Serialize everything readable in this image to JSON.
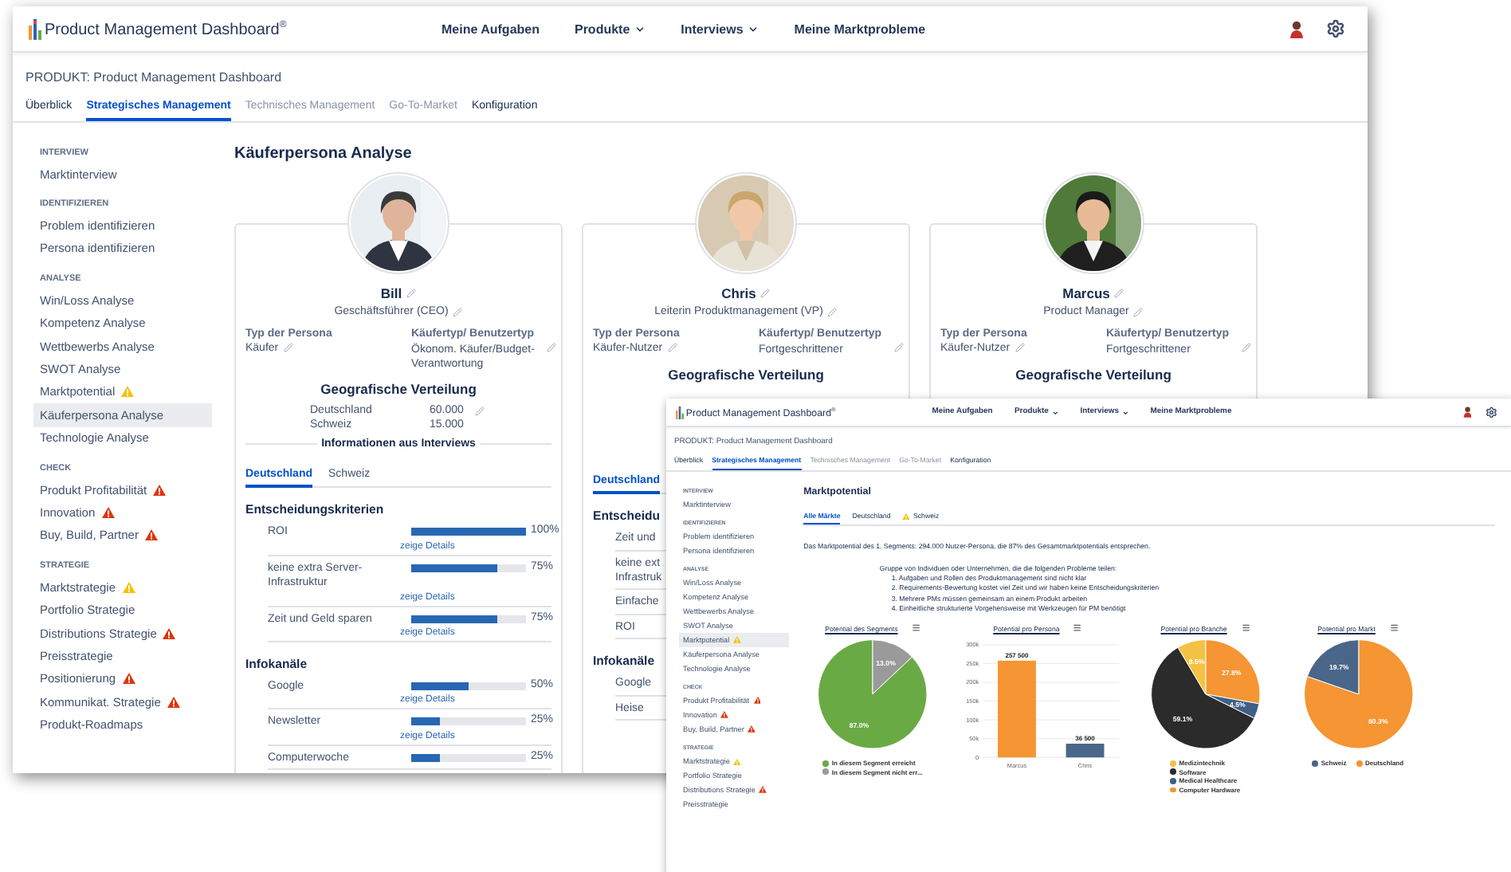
{
  "main_window": {
    "app_title": "Product Management Dashboard$^{®}$",
    "nav": [
      {
        "label": "Meine Aufgaben",
        "dropdown": false
      },
      {
        "label": "Produkte",
        "dropdown": true
      },
      {
        "label": "Interviews",
        "dropdown": true
      },
      {
        "label": "Meine Marktprobleme",
        "dropdown": false
      }
    ],
    "product_line": "PRODUKT: Product Management Dashboard",
    "tabs": [
      {
        "label": "Überblick",
        "selected": false,
        "disabled": false
      },
      {
        "label": "Strategisches Management",
        "selected": true,
        "disabled": false
      },
      {
        "label": "Technisches Management",
        "selected": false,
        "disabled": true
      },
      {
        "label": "Go-To-Market",
        "selected": false,
        "disabled": true
      },
      {
        "label": "Konfiguration",
        "selected": false,
        "disabled": false
      }
    ],
    "sidebar": [
      {
        "heading": "INTERVIEW",
        "items": [
          {
            "label": "Marktinterview",
            "selected": false
          }
        ]
      },
      {
        "heading": "IDENTIFIZIEREN",
        "items": [
          {
            "label": "Problem identifizieren",
            "selected": false
          },
          {
            "label": "Persona identifizieren",
            "selected": false
          }
        ]
      },
      {
        "heading": "ANALYSE",
        "items": [
          {
            "label": "Win/Loss Analyse",
            "selected": false
          },
          {
            "label": "Kompetenz Analyse",
            "selected": false
          },
          {
            "label": "Wettbewerbs Analyse",
            "selected": false
          },
          {
            "label": "SWOT Analyse",
            "selected": false
          },
          {
            "label": "Marktpotential",
            "selected": false,
            "color": "#f2c200"
          },
          {
            "label": "Käuferpersona Analyse",
            "selected": true
          },
          {
            "label": "Technologie Analyse",
            "selected": false
          }
        ]
      },
      {
        "heading": "CHECK",
        "items": [
          {
            "label": "Produkt Profitabilität",
            "selected": false,
            "color": "#de350b"
          },
          {
            "label": "Innovation",
            "selected": false,
            "color": "#de350b"
          },
          {
            "label": "Buy, Build, Partner",
            "selected": false,
            "color": "#de350b"
          }
        ]
      },
      {
        "heading": "STRATEGIE",
        "items": [
          {
            "label": "Marktstrategie",
            "selected": false,
            "color": "#f2c200"
          },
          {
            "label": "Portfolio Strategie",
            "selected": false
          },
          {
            "label": "Distributions Strategie",
            "selected": false,
            "color": "#de350b"
          },
          {
            "label": "Preisstrategie",
            "selected": false
          },
          {
            "label": "Positionierung",
            "selected": false,
            "color": "#de350b"
          },
          {
            "label": "Kommunikat. Strategie",
            "selected": false,
            "color": "#de350b"
          },
          {
            "label": "Produkt-Roadmaps",
            "selected": false
          }
        ]
      }
    ],
    "page_title": "Käuferpersona Analyse",
    "personas": [
      {
        "name": "Bill",
        "role": "Geschäftsführer (CEO)",
        "type_label": "Typ der Persona",
        "type": "Käufer",
        "buyer_label": "Käufertyp/ Benutzertyp",
        "buyer": "Ökonom. Käufer/Budget-Verantwortung",
        "geo_title": "Geografische Verteilung",
        "geo": [
          {
            "country": "Deutschland",
            "value": "60.000"
          },
          {
            "country": "Schweiz",
            "value": "15.000"
          }
        ],
        "interviews_title": "Informationen aus Interviews",
        "tabs": [
          {
            "label": "Deutschland",
            "selected": true
          },
          {
            "label": "Schweiz",
            "selected": false
          }
        ],
        "sections": [
          {
            "title": "Entscheidungskriterien",
            "rows": [
              {
                "label": "ROI",
                "level": 1,
                "reading": "100%",
                "link": "zeige Details"
              },
              {
                "label": "keine extra Server-Infrastruktur",
                "level": 0.75,
                "reading": "75%",
                "link": "zeige Details"
              },
              {
                "label": "Zeit und Geld sparen",
                "level": 0.75,
                "reading": "75%",
                "link": "zeige Details"
              }
            ]
          },
          {
            "title": "Infokanäle",
            "rows": [
              {
                "label": "Google",
                "level": 0.5,
                "reading": "50%",
                "link": "zeige Details"
              },
              {
                "label": "Newsletter",
                "level": 0.25,
                "reading": "25%",
                "link": "zeige Details"
              },
              {
                "label": "Computerwoche",
                "level": 0.25,
                "reading": "25%"
              }
            ]
          }
        ]
      },
      {
        "name": "Chris",
        "role": "Leiterin Produktmanagement (VP)",
        "type_label": "Typ der Persona",
        "type": "Käufer-Nutzer",
        "buyer_label": "Käufertyp/ Benutzertyp",
        "buyer": "Fortgeschrittener",
        "geo_title": "Geografische Verteilung",
        "tabs": [
          {
            "label": "Deutschland",
            "selected": true
          }
        ],
        "sections": [
          {
            "title": "Entscheidu",
            "rows": [
              {
                "label": "Zeit und"
              },
              {
                "label": "keine ext Infrastruk"
              },
              {
                "label": "Einfache"
              },
              {
                "label": "ROI"
              }
            ]
          },
          {
            "title": "Infokanäle",
            "rows": [
              {
                "label": "Google"
              },
              {
                "label": "Heise"
              }
            ]
          }
        ]
      },
      {
        "name": "Marcus",
        "role": "Product Manager",
        "type_label": "Typ der Persona",
        "type": "Käufer-Nutzer",
        "buyer_label": "Käufertyp/ Benutzertyp",
        "buyer": "Fortgeschrittener",
        "geo_title": "Geografische Verteilung"
      }
    ]
  },
  "overlay_window": {
    "app_title": "Product Management Dashboard$^{®}$",
    "nav": [
      {
        "label": "Meine Aufgaben",
        "dropdown": false
      },
      {
        "label": "Produkte",
        "dropdown": true
      },
      {
        "label": "Interviews",
        "dropdown": true
      },
      {
        "label": "Meine Marktprobleme",
        "dropdown": false
      }
    ],
    "product_line": "PRODUKT: Product Management Dashboard",
    "tabs": [
      {
        "label": "Überblick",
        "selected": false,
        "disabled": false
      },
      {
        "label": "Strategisches Management",
        "selected": true,
        "disabled": false
      },
      {
        "label": "Technisches Management",
        "selected": false,
        "disabled": true
      },
      {
        "label": "Go-To-Market",
        "selected": false,
        "disabled": true
      },
      {
        "label": "Konfiguration",
        "selected": false,
        "disabled": false
      }
    ],
    "sidebar": [
      {
        "heading": "INTERVIEW",
        "items": [
          {
            "label": "Marktinterview",
            "selected": false
          }
        ]
      },
      {
        "heading": "IDENTIFIZIEREN",
        "items": [
          {
            "label": "Problem identifizieren",
            "selected": false
          },
          {
            "label": "Persona identifizieren",
            "selected": false
          }
        ]
      },
      {
        "heading": "ANALYSE",
        "items": [
          {
            "label": "Win/Loss Analyse",
            "selected": false
          },
          {
            "label": "Kompetenz Analyse",
            "selected": false
          },
          {
            "label": "Wettbewerbs Analyse",
            "selected": false
          },
          {
            "label": "SWOT Analyse",
            "selected": false
          },
          {
            "label": "Marktpotential",
            "selected": true,
            "color": "#f2c200"
          },
          {
            "label": "Käuferpersona Analyse",
            "selected": false
          },
          {
            "label": "Technologie Analyse",
            "selected": false
          }
        ]
      },
      {
        "heading": "CHECK",
        "items": [
          {
            "label": "Produkt Profitabilität",
            "selected": false,
            "color": "#de350b"
          },
          {
            "label": "Innovation",
            "selected": false,
            "color": "#de350b"
          },
          {
            "label": "Buy, Build, Partner",
            "selected": false,
            "color": "#de350b"
          }
        ]
      },
      {
        "heading": "STRATEGIE",
        "items": [
          {
            "label": "Marktstrategie",
            "selected": false,
            "color": "#f2c200"
          },
          {
            "label": "Portfolio Strategie",
            "selected": false
          },
          {
            "label": "Distributions Strategie",
            "selected": false,
            "color": "#de350b"
          },
          {
            "label": "Preisstrategie",
            "selected": false
          }
        ]
      }
    ],
    "page_title": "Marktpotential",
    "market_tabs": [
      {
        "label": "Alle Märkte",
        "selected": true
      },
      {
        "label": "Deutschland",
        "selected": false
      },
      {
        "label": "Schweiz",
        "selected": false,
        "color": "#f2c200"
      }
    ],
    "summary": "Das Marktpotential des 1. Segments: 294.000 Nutzer-Persona, die 87% des Gesamtmarktpotentials entsprechen.",
    "problems_intro": "Gruppe von Individuen oder Unternehmen, die die folgenden Probleme teilen:",
    "problems": [
      "1. Aufgaben und Rollen des Produktmanagement sind nicht klar",
      "2. Requirements-Bewertung kostet viel Zeit und wir haben keine Entscheidungskriterien",
      "3. Mehrere PMs müssen gemeinsam an einem Produkt arbeiten",
      "4. Einheitliche strukturierte Vorgehensweise mit Werkzeugen für PM benötigt"
    ],
    "charts": [
      {
        "chart_data": {
          "type": "pie",
          "title": "Potential des Segments",
          "categories": [
            "In diesem Segment erreicht",
            "In diesem Segment nicht err..."
          ],
          "colors": [
            "#6aaa45",
            "#9a9a9a"
          ],
          "series": [
            {
              "values": [
                87.0,
                13.0
              ]
            }
          ],
          "legend": "bottom",
          "value_labels": [
            "87.0%",
            "13.0%"
          ]
        }
      },
      {
        "chart_data": {
          "type": "bar",
          "title": "Potential pro Persona",
          "categories": [
            "Marcus",
            "Chris"
          ],
          "colors": [
            "#f59533",
            "#4a6688"
          ],
          "series": [
            {
              "values": [
                257500,
                36500
              ]
            }
          ],
          "grid": true,
          "ylim": [
            0,
            300000
          ],
          "yticks": [
            {
              "value": 0,
              "label": "0"
            },
            {
              "value": 50000,
              "label": "50k"
            },
            {
              "value": 100000,
              "label": "100k"
            },
            {
              "value": 150000,
              "label": "150k"
            },
            {
              "value": 200000,
              "label": "200k"
            },
            {
              "value": 250000,
              "label": "250k"
            },
            {
              "value": 300000,
              "label": "300k"
            }
          ],
          "value_labels": [
            "257 500",
            "36 500"
          ]
        }
      },
      {
        "chart_data": {
          "type": "pie",
          "title": "Potential pro Branche",
          "categories": [
            "Medizintechnik",
            "Software",
            "Medical Healthcare",
            "Computer Hardware"
          ],
          "colors": [
            "#f4c242",
            "#2b2b2b",
            "#3f5f85",
            "#f59533"
          ],
          "series": [
            {
              "values": [
                8.5,
                59.1,
                4.5,
                27.8
              ]
            }
          ],
          "legend": "bottom",
          "value_labels": [
            "8.5%",
            "59.1%",
            "4.5%",
            "27.8%"
          ]
        }
      },
      {
        "chart_data": {
          "type": "pie",
          "title": "Potential pro Markt",
          "categories": [
            "Schweiz",
            "Deutschland"
          ],
          "colors": [
            "#4a6688",
            "#f59533"
          ],
          "series": [
            {
              "values": [
                19.7,
                80.3
              ]
            }
          ],
          "legend": "bottom",
          "value_labels": [
            "19.7%",
            "80.3%"
          ]
        }
      }
    ]
  }
}
